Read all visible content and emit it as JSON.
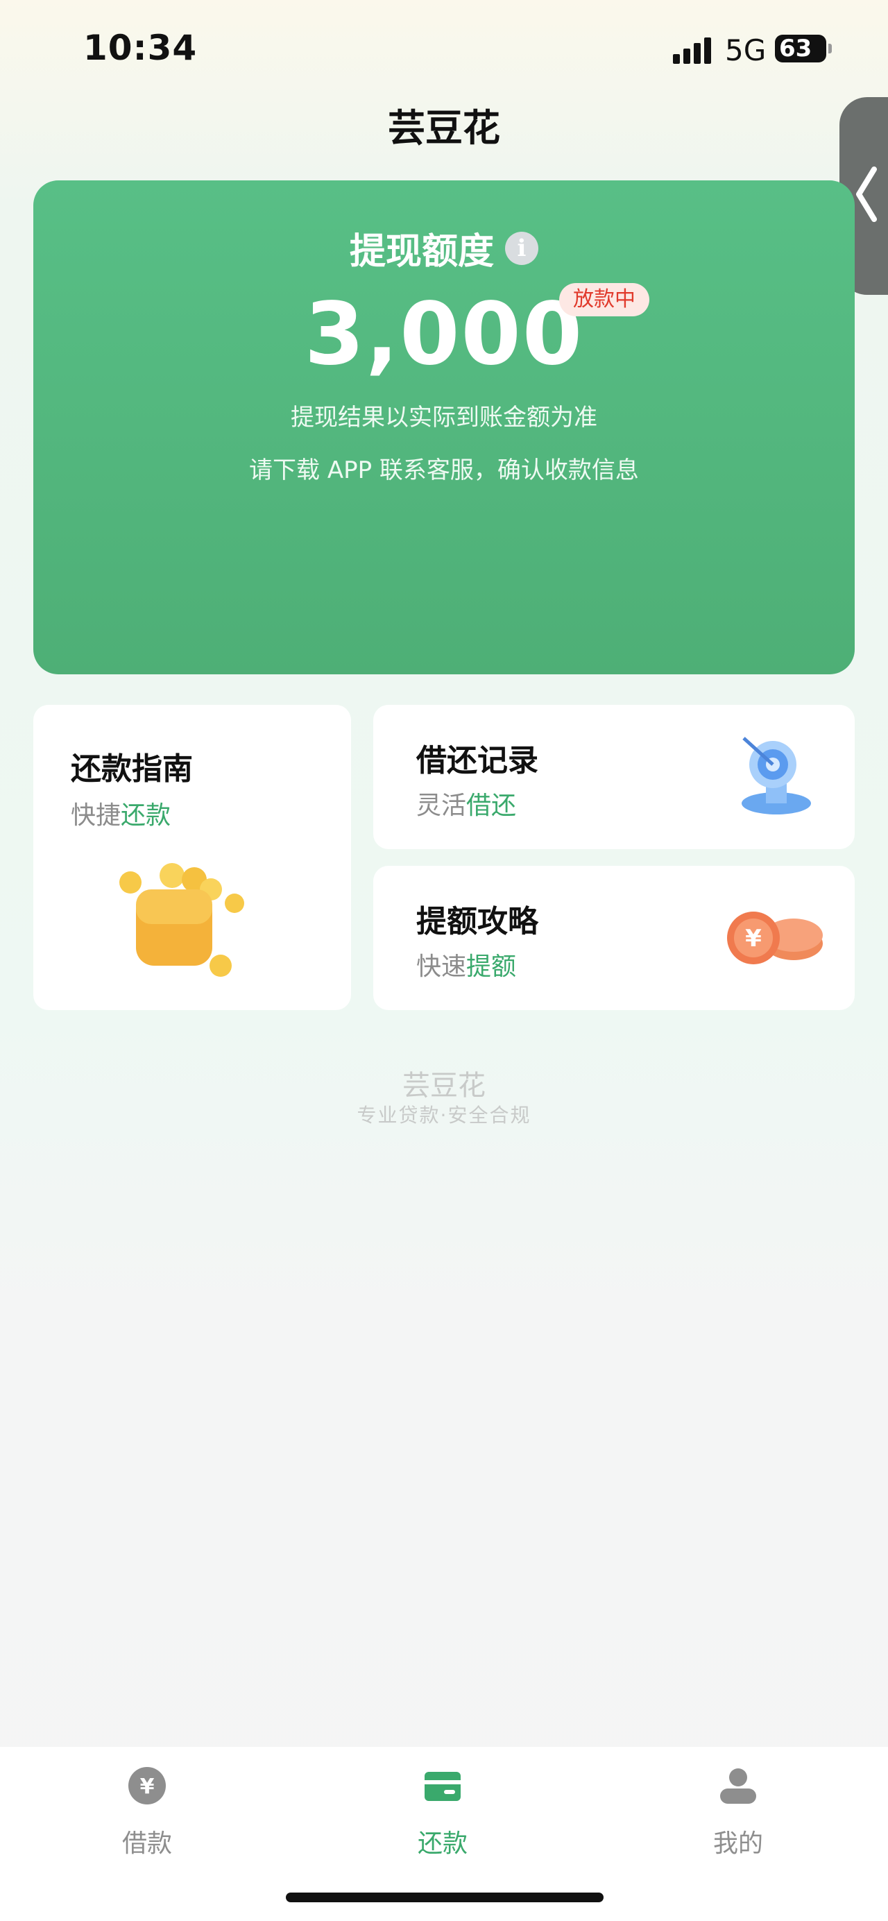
{
  "status_bar": {
    "time": "10:34",
    "network": "5G",
    "battery": "63"
  },
  "header": {
    "title": "芸豆花"
  },
  "hero": {
    "label": "提现额度",
    "amount": "3,000",
    "badge": "放款中",
    "line1": "提现结果以实际到账金额为准",
    "line2": "请下载 APP 联系客服，确认收款信息"
  },
  "cards": {
    "guide": {
      "title": "还款指南",
      "sub_plain": "快捷",
      "sub_accent": "还款"
    },
    "records": {
      "title": "借还记录",
      "sub_plain": "灵活",
      "sub_accent": "借还"
    },
    "raise": {
      "title": "提额攻略",
      "sub_plain": "快速",
      "sub_accent": "提额"
    }
  },
  "footer": {
    "brand": "芸豆花",
    "tagline": "专业贷款·安全合规"
  },
  "tabs": [
    {
      "label": "借款",
      "icon": "yen-circle-icon",
      "active": false
    },
    {
      "label": "还款",
      "icon": "wallet-card-icon",
      "active": true
    },
    {
      "label": "我的",
      "icon": "person-icon",
      "active": false
    }
  ],
  "colors": {
    "accent": "#3aa96c",
    "hero_green": "#52b47b",
    "badge_red": "#e13a2c"
  }
}
